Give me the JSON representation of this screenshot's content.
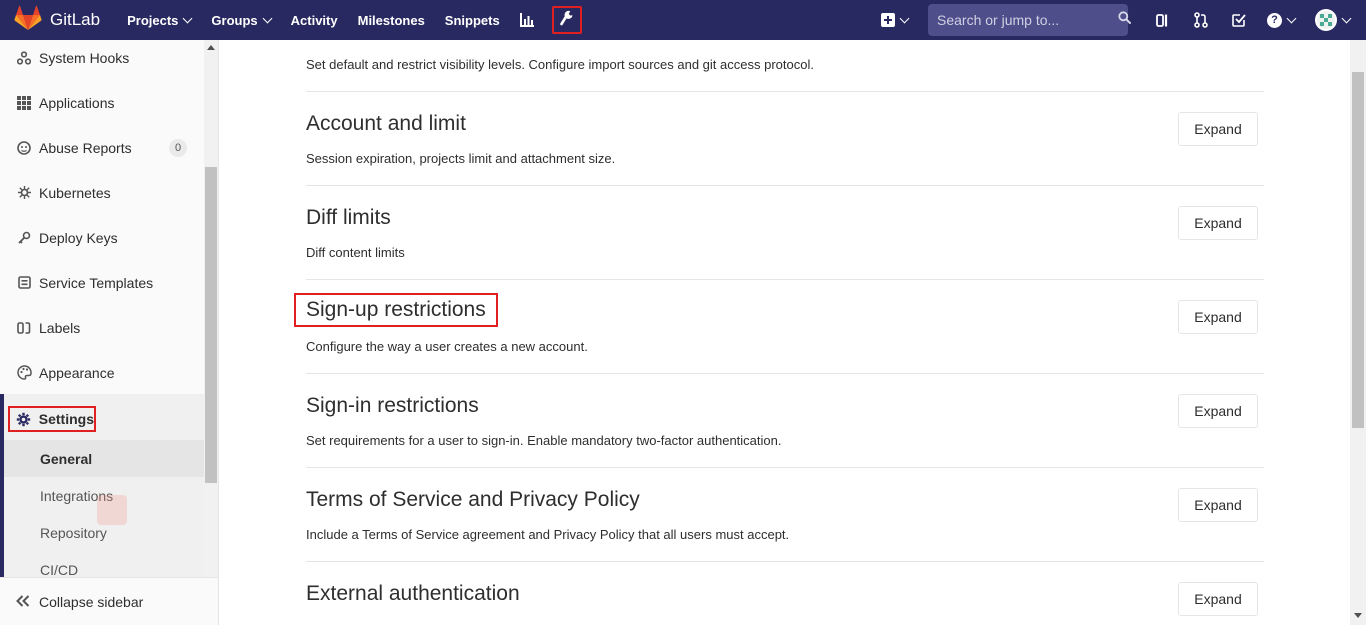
{
  "navbar": {
    "brand": "GitLab",
    "links": [
      {
        "label": "Projects",
        "dropdown": true
      },
      {
        "label": "Groups",
        "dropdown": true
      },
      {
        "label": "Activity",
        "dropdown": false
      },
      {
        "label": "Milestones",
        "dropdown": false
      },
      {
        "label": "Snippets",
        "dropdown": false
      }
    ],
    "icons": [
      "chart-icon",
      "wrench-icon",
      "plus-square-icon",
      "sidebar-toggle-icon",
      "merge-request-icon",
      "todo-check-icon",
      "help-icon",
      "user-avatar"
    ],
    "search_placeholder": "Search or jump to...",
    "help_glyph": "?",
    "accent_color": "#292961",
    "highlight_color": "#e02020"
  },
  "sidebar": {
    "items": [
      {
        "label": "System Hooks",
        "icon": "hook-icon"
      },
      {
        "label": "Applications",
        "icon": "grid-icon"
      },
      {
        "label": "Abuse Reports",
        "icon": "face-icon",
        "badge": "0"
      },
      {
        "label": "Kubernetes",
        "icon": "kubernetes-icon"
      },
      {
        "label": "Deploy Keys",
        "icon": "key-icon"
      },
      {
        "label": "Service Templates",
        "icon": "template-icon"
      },
      {
        "label": "Labels",
        "icon": "labels-icon"
      },
      {
        "label": "Appearance",
        "icon": "palette-icon"
      }
    ],
    "active": {
      "label": "Settings",
      "icon": "gear-icon"
    },
    "subitems": [
      {
        "label": "General",
        "active": true
      },
      {
        "label": "Integrations",
        "active": false
      },
      {
        "label": "Repository",
        "active": false
      },
      {
        "label": "CI/CD",
        "active": false
      }
    ],
    "collapse_label": "Collapse sidebar"
  },
  "main": {
    "expand_label": "Expand",
    "sections": [
      {
        "title": "",
        "description": "Set default and restrict visibility levels. Configure import sources and git access protocol."
      },
      {
        "title": "Account and limit",
        "description": "Session expiration, projects limit and attachment size."
      },
      {
        "title": "Diff limits",
        "description": "Diff content limits"
      },
      {
        "title": "Sign-up restrictions",
        "description": "Configure the way a user creates a new account."
      },
      {
        "title": "Sign-in restrictions",
        "description": "Set requirements for a user to sign-in. Enable mandatory two-factor authentication."
      },
      {
        "title": "Terms of Service and Privacy Policy",
        "description": "Include a Terms of Service agreement and Privacy Policy that all users must accept."
      },
      {
        "title": "External authentication",
        "description": ""
      }
    ]
  }
}
